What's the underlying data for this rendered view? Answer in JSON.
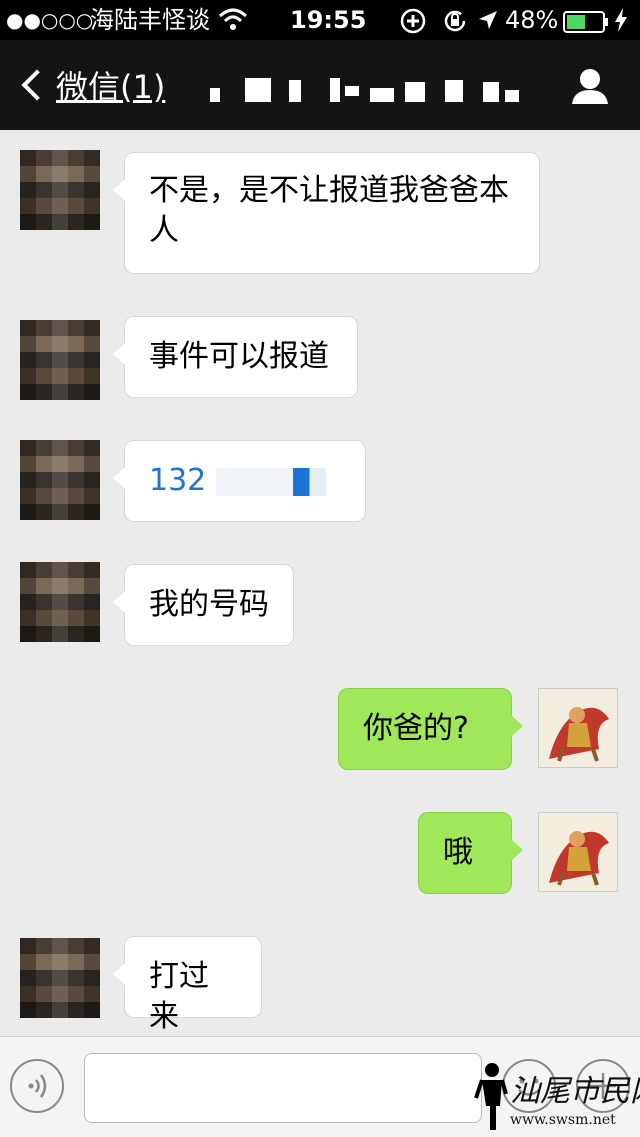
{
  "status_bar": {
    "signal": "●●○○○",
    "carrier": "海陆丰怪谈",
    "time": "19:55",
    "battery": "48%"
  },
  "nav": {
    "back_label": "微信(1)",
    "chat_title": ""
  },
  "messages": [
    {
      "side": "in",
      "text": "不是，是不让报道我爸爸本人"
    },
    {
      "side": "in",
      "text": "事件可以报道"
    },
    {
      "side": "in",
      "text": "132",
      "is_phone": true
    },
    {
      "side": "in",
      "text": "我的号码"
    },
    {
      "side": "out",
      "text": "你爸的?"
    },
    {
      "side": "out",
      "text": "哦"
    },
    {
      "side": "in",
      "text": "打过来"
    }
  ],
  "input_bar": {
    "placeholder": ""
  },
  "watermark": {
    "text": "汕尾市民网",
    "url": "www.swsm.net"
  },
  "colors": {
    "outgoing_bubble": "#a0e75a",
    "incoming_bubble": "#ffffff",
    "phone_link": "#1a75d6",
    "battery": "#4cd964"
  }
}
